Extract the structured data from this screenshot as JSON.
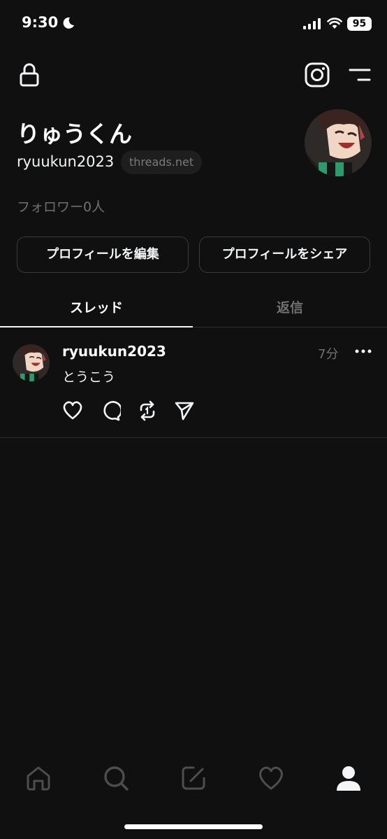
{
  "status_bar": {
    "time": "9:30",
    "battery": "95"
  },
  "profile": {
    "display_name": "りゅうくん",
    "username": "ryuukun2023",
    "domain_badge": "threads.net",
    "followers": "フォロワー0人",
    "edit_button": "プロフィールを編集",
    "share_button": "プロフィールをシェア"
  },
  "tabs": [
    {
      "label": "スレッド",
      "active": true
    },
    {
      "label": "返信",
      "active": false
    }
  ],
  "post": {
    "username": "ryuukun2023",
    "time": "7分",
    "text": "とうこう"
  },
  "icons": {
    "top": [
      "lock-icon",
      "instagram-icon",
      "menu-icon"
    ],
    "post_actions": [
      "heart-icon",
      "comment-icon",
      "repost-icon",
      "send-icon"
    ],
    "nav": [
      "home-icon",
      "search-icon",
      "compose-icon",
      "heart-icon",
      "profile-icon"
    ]
  },
  "colors": {
    "background": "#101010",
    "text": "#f3f5f7",
    "muted": "#6f6f6f",
    "border": "#3a3a3a"
  }
}
